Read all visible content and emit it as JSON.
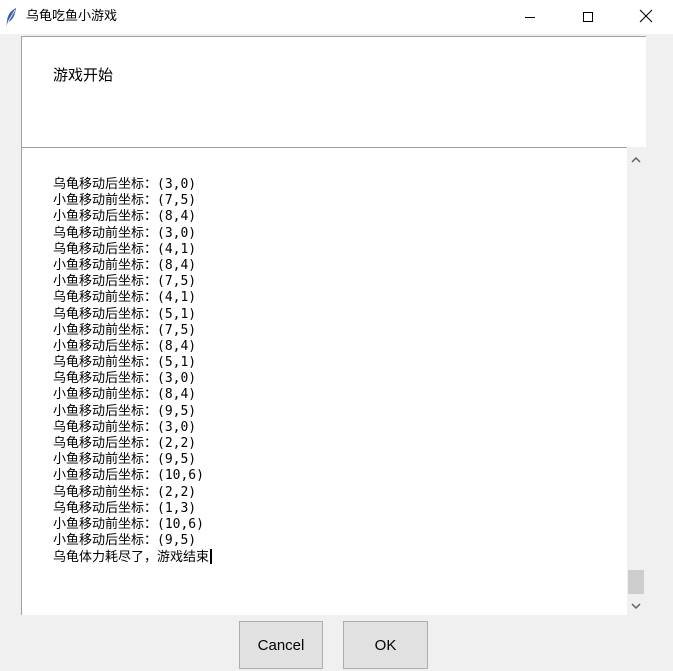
{
  "window": {
    "title": "乌龟吃鱼小游戏"
  },
  "top_panel": {
    "label": "游戏开始"
  },
  "log": {
    "lines": [
      "乌龟移动后坐标：(3,0)",
      "小鱼移动前坐标：(7,5)",
      "小鱼移动后坐标：(8,4)",
      "乌龟移动前坐标：(3,0)",
      "乌龟移动后坐标：(4,1)",
      "小鱼移动前坐标：(8,4)",
      "小鱼移动后坐标：(7,5)",
      "乌龟移动前坐标：(4,1)",
      "乌龟移动后坐标：(5,1)",
      "小鱼移动前坐标：(7,5)",
      "小鱼移动后坐标：(8,4)",
      "乌龟移动前坐标：(5,1)",
      "乌龟移动后坐标：(3,0)",
      "小鱼移动前坐标：(8,4)",
      "小鱼移动后坐标：(9,5)",
      "乌龟移动前坐标：(3,0)",
      "乌龟移动后坐标：(2,2)",
      "小鱼移动前坐标：(9,5)",
      "小鱼移动后坐标：(10,6)",
      "乌龟移动前坐标：(2,2)",
      "乌龟移动后坐标：(1,3)",
      "小鱼移动前坐标：(10,6)",
      "小鱼移动后坐标：(9,5)"
    ],
    "end_message": "乌龟体力耗尽了，游戏结束"
  },
  "buttons": {
    "cancel_label": "Cancel",
    "ok_label": "OK"
  },
  "scrollbar": {
    "position": 1.0
  },
  "icons": {
    "app": "feather-icon",
    "minimize": "minimize-icon",
    "maximize": "maximize-icon",
    "close": "close-icon",
    "scroll_up": "chevron-up-icon",
    "scroll_down": "chevron-down-icon"
  },
  "colors": {
    "titlebar": "#ffffff",
    "background": "#f0f0f0",
    "text_bg": "#ffffff",
    "button_bg": "#e1e1e1",
    "scroll_thumb": "#cdcdcd"
  }
}
